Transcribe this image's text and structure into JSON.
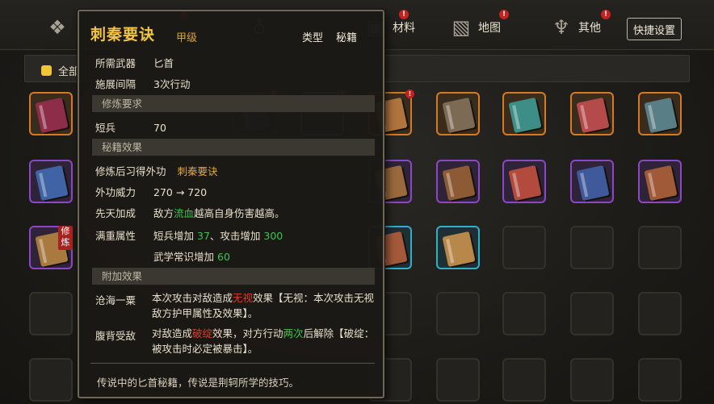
{
  "tabs": [
    {
      "label": "",
      "icon": "scroll-icon",
      "has_alert": true
    },
    {
      "label": "",
      "icon": "bag-icon",
      "has_alert": true
    },
    {
      "label": "",
      "icon": "flask-icon",
      "has_alert": true
    },
    {
      "label": "材料",
      "icon": "material-icon",
      "has_alert": true
    },
    {
      "label": "地图",
      "icon": "map-icon",
      "has_alert": true
    },
    {
      "label": "其他",
      "icon": "misc-icon",
      "has_alert": true
    }
  ],
  "quick_settings_label": "快捷设置",
  "filter": {
    "all_label": "全部"
  },
  "slot_badge_label": "修炼",
  "alert_glyph": "!",
  "tooltip": {
    "title": "刺秦要诀",
    "grade": "甲级",
    "type_label": "类型",
    "type_value": "秘籍",
    "weapon_label": "所需武器",
    "weapon_value": "匕首",
    "interval_label": "施展间隔",
    "interval_value": "3次行动",
    "req_section": "修炼要求",
    "req_label": "短兵",
    "req_value": "70",
    "effect_section": "秘籍效果",
    "learn_label": "修炼后习得外功",
    "learn_value": "刺秦要诀",
    "power_label": "外功威力",
    "power_value": "270 → 720",
    "innate_label": "先天加成",
    "innate_pre": "敌方",
    "innate_hl": "流血",
    "innate_post": "越高自身伤害越高。",
    "full_label": "满重属性",
    "full_line1_a": "短兵增加",
    "full_line1_b": "37",
    "full_line1_c": "、攻击增加",
    "full_line1_d": "300",
    "full_line2_a": "武学常识增加",
    "full_line2_b": "60",
    "bonus_section": "附加效果",
    "b1_label": "沧海一粟",
    "b1_a": "本次攻击对敌造成",
    "b1_hl": "无视",
    "b1_b": "效果【无视：本次攻击无视敌方护甲属性及效果】。",
    "b2_label": "腹背受敌",
    "b2_a": "对敌造成",
    "b2_hl": "破绽",
    "b2_b": "效果，对方行动",
    "b2_hl2": "两次",
    "b2_c": "后解除【破绽：被攻击时必定被暴击】。",
    "flavor": "传说中的匕首秘籍，传说是荆轲所学的技巧。"
  },
  "colors": {
    "gold": "#f2c542",
    "highlight_green": "#3cc44a",
    "highlight_red": "#e33a2c",
    "rarity_orange": "#d57a23",
    "rarity_purple": "#8c46c6",
    "rarity_cyan": "#2fb0c8"
  }
}
